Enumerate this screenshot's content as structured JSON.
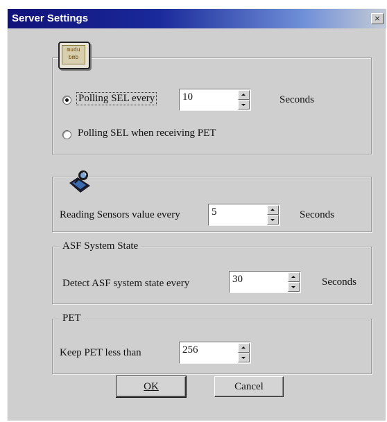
{
  "window": {
    "title": "Server Settings",
    "close_glyph": "×"
  },
  "sel_group": {
    "icon": "sel-log-icon",
    "icon_lines": [
      "mudu",
      "bmb"
    ],
    "option_polling_label": "Polling SEL every",
    "polling_value": "10",
    "polling_unit": "Seconds",
    "option_pet_label": "Polling SEL when receiving PET",
    "selected": "polling"
  },
  "sensor_group": {
    "icon": "sensor-satellite-icon",
    "label": "Reading Sensors value every",
    "value": "5",
    "unit": "Seconds"
  },
  "asf_group": {
    "legend": "ASF System State",
    "label": "Detect ASF system state every",
    "value": "30",
    "unit": "Seconds"
  },
  "pet_group": {
    "legend": "PET",
    "label": "Keep PET less than",
    "value": "256"
  },
  "buttons": {
    "ok_label": "OK",
    "cancel_label": "Cancel"
  },
  "colors": {
    "title_bar_start": "#11117a",
    "title_bar_end": "#c4cbd6",
    "face": "#cfcfcf"
  }
}
